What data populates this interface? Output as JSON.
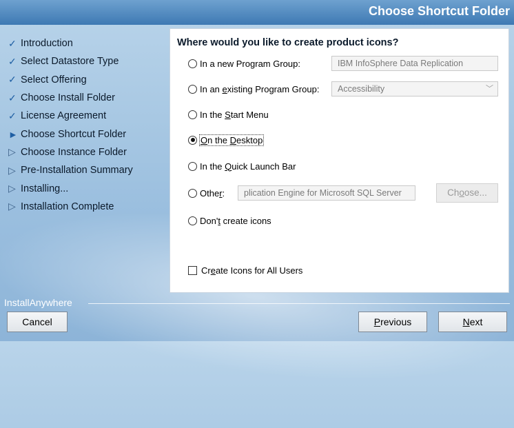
{
  "window": {
    "title": "Choose Shortcut Folder"
  },
  "steps": [
    {
      "label": "Introduction",
      "state": "done"
    },
    {
      "label": "Select Datastore Type",
      "state": "done"
    },
    {
      "label": "Select Offering",
      "state": "done"
    },
    {
      "label": "Choose Install Folder",
      "state": "done"
    },
    {
      "label": "License Agreement",
      "state": "done"
    },
    {
      "label": "Choose Shortcut Folder",
      "state": "current"
    },
    {
      "label": "Choose Instance Folder",
      "state": "pending"
    },
    {
      "label": "Pre-Installation Summary",
      "state": "pending"
    },
    {
      "label": "Installing...",
      "state": "pending"
    },
    {
      "label": "Installation Complete",
      "state": "pending"
    }
  ],
  "panel": {
    "question": "Where would you like to create product icons?",
    "options": {
      "new_group": {
        "pre": "In a new Pro",
        "key": "g",
        "post": "ram Group:",
        "value": "IBM InfoSphere Data Replication"
      },
      "existing_group": {
        "pre": "In an ",
        "key": "e",
        "post": "xisting Program Group:",
        "value": "Accessibility"
      },
      "start_menu": {
        "pre": "In the ",
        "key": "S",
        "post": "tart Menu"
      },
      "desktop": {
        "pre": "",
        "key": "O",
        "post": "n the ",
        "key2": "D",
        "post2": "esktop"
      },
      "quick_launch": {
        "pre": "In the ",
        "key": "Q",
        "post": "uick Launch Bar"
      },
      "other": {
        "pre": "Othe",
        "key": "r",
        "post": ":",
        "value": "plication Engine for Microsoft SQL Server",
        "choose_pre": "Ch",
        "choose_key": "o",
        "choose_post": "ose..."
      },
      "none": {
        "pre": "Don'",
        "key": "t",
        "post": " create icons"
      }
    },
    "selected": "desktop",
    "all_users": {
      "pre": "Cr",
      "key": "e",
      "post": "ate Icons for All Users",
      "checked": false
    }
  },
  "footer": {
    "brand": "InstallAnywhere",
    "cancel": "Cancel",
    "previous_key": "P",
    "previous_rest": "revious",
    "next_key": "N",
    "next_rest": "ext"
  },
  "icons": {
    "done": "✓",
    "current": "►",
    "pending": "▷",
    "chevron": "﹀"
  }
}
